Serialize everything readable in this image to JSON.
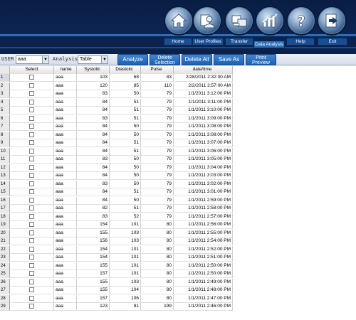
{
  "nav": {
    "items": [
      {
        "label": "Home",
        "icon": "home-icon"
      },
      {
        "label": "User Profiles",
        "icon": "user-profiles-icon"
      },
      {
        "label": "Transfer",
        "icon": "transfer-icon"
      },
      {
        "label": "Data Analysis",
        "icon": "data-analysis-icon"
      },
      {
        "label": "Help",
        "icon": "help-icon"
      },
      {
        "label": "Exit",
        "icon": "exit-icon"
      }
    ]
  },
  "toolbar": {
    "user_label": "USER",
    "user_value": "aaa",
    "analysis_label": "Analysis",
    "analysis_value": "Table",
    "analyze": "Analyze",
    "delete_selection_line1": "Delete",
    "delete_selection_line2": "Selection",
    "delete_all": "Delete All",
    "save_as": "Save As",
    "print_preview_line1": "Print",
    "print_preview_line2": "Preview"
  },
  "table": {
    "columns": [
      "Select",
      "name",
      "Systolic",
      "Diastolic",
      "Pulse",
      "date/time"
    ],
    "rows": [
      {
        "idx": "1",
        "name": "aaa",
        "sys": "103",
        "dia": "68",
        "pulse": "83",
        "dt": "2/28/2011 2:32:00 AM"
      },
      {
        "idx": "2",
        "name": "aaa",
        "sys": "120",
        "dia": "85",
        "pulse": "110",
        "dt": "2/2/2011 2:57:00 AM"
      },
      {
        "idx": "3",
        "name": "aaa",
        "sys": "83",
        "dia": "50",
        "pulse": "79",
        "dt": "1/1/2011 3:12:00 PM"
      },
      {
        "idx": "4",
        "name": "aaa",
        "sys": "84",
        "dia": "51",
        "pulse": "79",
        "dt": "1/1/2011 3:11:00 PM"
      },
      {
        "idx": "5",
        "name": "aaa",
        "sys": "84",
        "dia": "51",
        "pulse": "79",
        "dt": "1/1/2011 3:10:00 PM"
      },
      {
        "idx": "6",
        "name": "aaa",
        "sys": "83",
        "dia": "51",
        "pulse": "79",
        "dt": "1/1/2011 3:09:00 PM"
      },
      {
        "idx": "7",
        "name": "aaa",
        "sys": "84",
        "dia": "50",
        "pulse": "79",
        "dt": "1/1/2011 3:08:00 PM"
      },
      {
        "idx": "8",
        "name": "aaa",
        "sys": "84",
        "dia": "50",
        "pulse": "79",
        "dt": "1/1/2011 3:08:00 PM"
      },
      {
        "idx": "9",
        "name": "aaa",
        "sys": "84",
        "dia": "51",
        "pulse": "79",
        "dt": "1/1/2011 3:07:00 PM"
      },
      {
        "idx": "10",
        "name": "aaa",
        "sys": "84",
        "dia": "51",
        "pulse": "79",
        "dt": "1/1/2011 3:06:00 PM"
      },
      {
        "idx": "11",
        "name": "aaa",
        "sys": "83",
        "dia": "50",
        "pulse": "79",
        "dt": "1/1/2011 3:05:00 PM"
      },
      {
        "idx": "12",
        "name": "aaa",
        "sys": "84",
        "dia": "50",
        "pulse": "79",
        "dt": "1/1/2011 3:04:00 PM"
      },
      {
        "idx": "13",
        "name": "aaa",
        "sys": "84",
        "dia": "50",
        "pulse": "79",
        "dt": "1/1/2011 3:03:00 PM"
      },
      {
        "idx": "14",
        "name": "aaa",
        "sys": "83",
        "dia": "50",
        "pulse": "79",
        "dt": "1/1/2011 3:02:00 PM"
      },
      {
        "idx": "15",
        "name": "aaa",
        "sys": "84",
        "dia": "51",
        "pulse": "79",
        "dt": "1/1/2011 3:01:00 PM"
      },
      {
        "idx": "16",
        "name": "aaa",
        "sys": "84",
        "dia": "50",
        "pulse": "79",
        "dt": "1/1/2011 2:59:00 PM"
      },
      {
        "idx": "17",
        "name": "aaa",
        "sys": "82",
        "dia": "51",
        "pulse": "79",
        "dt": "1/1/2011 2:58:00 PM"
      },
      {
        "idx": "18",
        "name": "aaa",
        "sys": "83",
        "dia": "52",
        "pulse": "79",
        "dt": "1/1/2011 2:57:00 PM"
      },
      {
        "idx": "19",
        "name": "aaa",
        "sys": "154",
        "dia": "101",
        "pulse": "80",
        "dt": "1/1/2011 2:56:00 PM"
      },
      {
        "idx": "20",
        "name": "aaa",
        "sys": "155",
        "dia": "103",
        "pulse": "80",
        "dt": "1/1/2011 2:55:00 PM"
      },
      {
        "idx": "21",
        "name": "aaa",
        "sys": "156",
        "dia": "103",
        "pulse": "80",
        "dt": "1/1/2011 2:54:00 PM"
      },
      {
        "idx": "22",
        "name": "aaa",
        "sys": "154",
        "dia": "101",
        "pulse": "80",
        "dt": "1/1/2011 2:52:00 PM"
      },
      {
        "idx": "23",
        "name": "aaa",
        "sys": "154",
        "dia": "101",
        "pulse": "80",
        "dt": "1/1/2011 2:51:00 PM"
      },
      {
        "idx": "24",
        "name": "aaa",
        "sys": "155",
        "dia": "101",
        "pulse": "80",
        "dt": "1/1/2011 2:50:00 PM"
      },
      {
        "idx": "25",
        "name": "aaa",
        "sys": "157",
        "dia": "101",
        "pulse": "80",
        "dt": "1/1/2011 2:50:00 PM"
      },
      {
        "idx": "26",
        "name": "aaa",
        "sys": "155",
        "dia": "103",
        "pulse": "80",
        "dt": "1/1/2011 2:49:00 PM"
      },
      {
        "idx": "27",
        "name": "aaa",
        "sys": "155",
        "dia": "104",
        "pulse": "80",
        "dt": "1/1/2011 2:48:00 PM"
      },
      {
        "idx": "28",
        "name": "aaa",
        "sys": "157",
        "dia": "106",
        "pulse": "80",
        "dt": "1/1/2011 2:47:00 PM"
      },
      {
        "idx": "29",
        "name": "aaa",
        "sys": "123",
        "dia": "81",
        "pulse": "199",
        "dt": "1/1/2011 2:46:00 PM"
      }
    ]
  }
}
